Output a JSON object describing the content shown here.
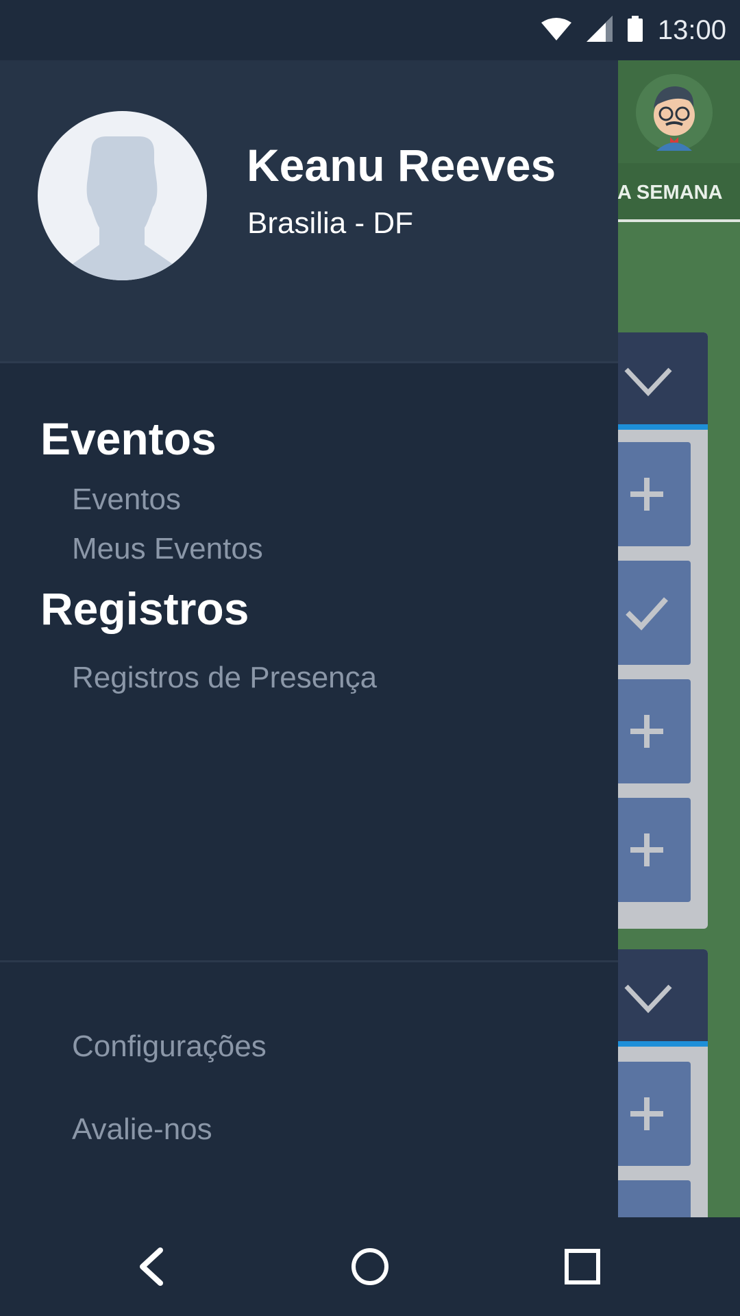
{
  "status_bar": {
    "time": "13:00",
    "icons": [
      "wifi-icon",
      "cell-signal-icon",
      "battery-icon"
    ]
  },
  "background_app": {
    "tab_label": "DA SEMANA",
    "slot_icons": [
      "plus-icon",
      "check-icon",
      "plus-icon",
      "plus-icon",
      "plus-icon"
    ]
  },
  "drawer": {
    "user": {
      "name": "Keanu Reeves",
      "location": "Brasilia - DF"
    },
    "sections": [
      {
        "title": "Eventos",
        "items": [
          "Eventos",
          "Meus Eventos"
        ]
      },
      {
        "title": "Registros",
        "items": [
          "Registros de Presença"
        ]
      }
    ],
    "footer_items": [
      "Configurações",
      "Avalie-nos"
    ]
  },
  "nav_bar": {
    "buttons": [
      "back-icon",
      "home-icon",
      "recents-icon"
    ]
  },
  "colors": {
    "drawer_bg": "#1e2b3d",
    "drawer_header_bg": "#263447",
    "menu_text": "#8b97a8",
    "bg_app_green": "#4a7a4c",
    "accent_blue": "#1e8fd8"
  }
}
